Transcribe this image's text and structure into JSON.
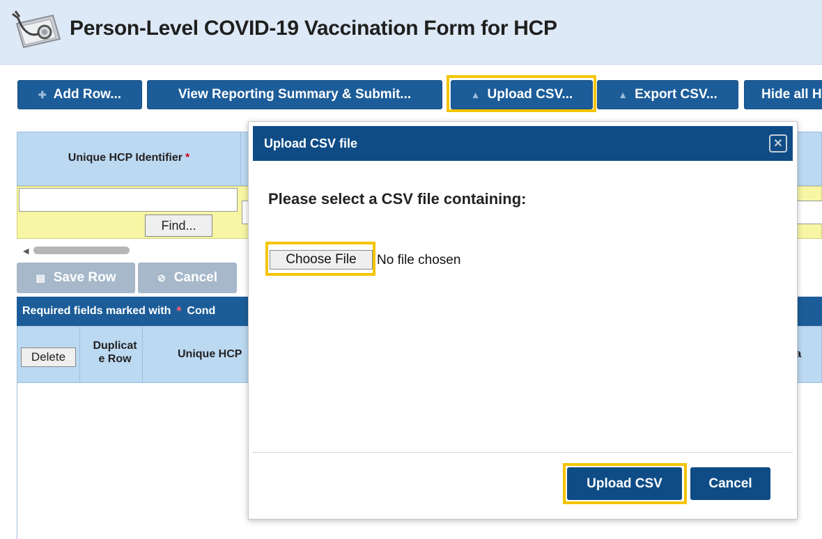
{
  "header": {
    "title": "Person-Level COVID-19 Vaccination Form for HCP",
    "logo_icon": "stethoscope-icon"
  },
  "toolbar": {
    "add_row": "Add Row...",
    "view_summary": "View Reporting Summary & Submit...",
    "upload_csv": "Upload CSV...",
    "export_csv": "Export CSV...",
    "hide_all": "Hide all H"
  },
  "grid": {
    "unique_id_label": "Unique HCP Identifier",
    "required_star": "*",
    "find_label": "Find..."
  },
  "row_actions": {
    "save_row": "Save Row",
    "cancel": "Cancel"
  },
  "required_bar": {
    "text": "Required fields marked with",
    "star": "*",
    "cond": "Cond"
  },
  "columns": {
    "delete_label": "Delete",
    "duplicate_line1": "Duplicat",
    "duplicate_line2": "e Row",
    "unique_hcp": "Unique HCP",
    "right_partial": "t Na"
  },
  "modal": {
    "title": "Upload CSV file",
    "close_icon": "close-icon",
    "prompt": "Please select a CSV file containing:",
    "choose_file": "Choose File",
    "no_file": "No file chosen",
    "upload_button": "Upload CSV",
    "cancel_button": "Cancel"
  },
  "colors": {
    "primary_button": "#1c5d99",
    "modal_header": "#0f4c86",
    "highlight": "#f5c400",
    "filter_row": "#f7f6a5",
    "grid_header": "#bcd9f2",
    "required_star": "#d0021b"
  }
}
